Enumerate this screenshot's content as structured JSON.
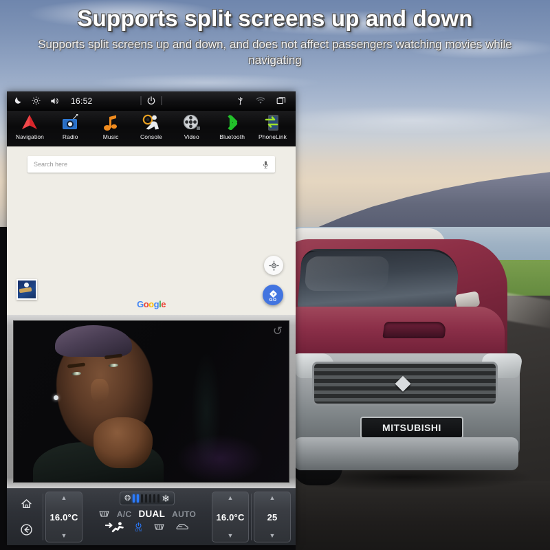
{
  "headline": {
    "title": "Supports split screens up and down",
    "subtitle": "Supports split screens up and down, and does not affect passengers watching movies while navigating"
  },
  "background": {
    "vehicle_plate": "MITSUBISHI",
    "scene": "pickup-truck-on-coastal-road"
  },
  "head_unit": {
    "status_bar": {
      "icons_left": [
        "night-mode-icon",
        "brightness-icon",
        "volume-icon"
      ],
      "time": "16:52",
      "power_icon": "power-icon",
      "icons_right": [
        "usb-icon",
        "wifi-icon",
        "recent-apps-icon"
      ]
    },
    "app_dock": [
      {
        "label": "Navigation",
        "icon": "navigation-arrow-icon"
      },
      {
        "label": "Radio",
        "icon": "radio-icon"
      },
      {
        "label": "Music",
        "icon": "music-note-icon"
      },
      {
        "label": "Console",
        "icon": "steering-wheel-driver-icon"
      },
      {
        "label": "Video",
        "icon": "film-reel-icon"
      },
      {
        "label": "Bluetooth",
        "icon": "bluetooth-icon"
      },
      {
        "label": "PhoneLink",
        "icon": "phone-link-icon"
      }
    ],
    "map": {
      "search_placeholder": "Search here",
      "mic_icon": "microphone-icon",
      "attribution": "Google",
      "attribution_letters": [
        "G",
        "o",
        "o",
        "g",
        "l",
        "e"
      ],
      "my_location_icon": "my-location-icon",
      "go_button_label": "GO",
      "layers_thumbnail": "satellite-layer-thumbnail",
      "accent_color": "#4274e0"
    },
    "video": {
      "back_icon": "back-arrow-icon",
      "content": "movie-playback"
    },
    "climate": {
      "home_icon": "home-icon",
      "back_icon": "back-circle-icon",
      "left_temp": "16.0°C",
      "right_temp": "16.0°C",
      "volume_value": "25",
      "fan": {
        "low_icon": "fan-small-icon",
        "high_icon": "fan-large-icon",
        "total_bars": 7,
        "active_bars": 2
      },
      "buttons_row1": [
        {
          "label": "",
          "icon": "rear-defrost-icon",
          "active": false
        },
        {
          "label": "A/C",
          "icon": "",
          "active": false
        },
        {
          "label": "DUAL",
          "icon": "",
          "active": true
        },
        {
          "label": "AUTO",
          "icon": "",
          "active": false
        }
      ],
      "buttons_row2": [
        {
          "label": "",
          "icon": "airflow-body-icon",
          "active": true
        },
        {
          "label": "ON",
          "icon": "power-icon",
          "active": true
        },
        {
          "label": "",
          "icon": "front-defrost-icon",
          "active": false
        },
        {
          "label": "",
          "icon": "windshield-defog-icon",
          "active": false
        }
      ],
      "on_color": "#2b7bff"
    }
  }
}
